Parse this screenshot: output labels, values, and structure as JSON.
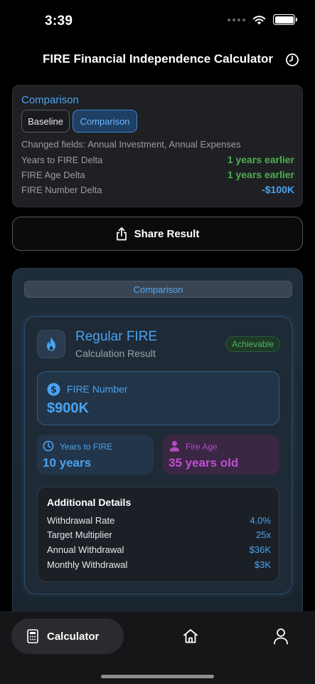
{
  "status": {
    "time": "3:39"
  },
  "header": {
    "title": "FIRE Financial Independence Calculator"
  },
  "comparison": {
    "heading": "Comparison",
    "segments": {
      "baseline": "Baseline",
      "comparison": "Comparison"
    },
    "changed_fields": "Changed fields: Annual Investment, Annual Expenses",
    "deltas": [
      {
        "label": "Years to FIRE Delta",
        "value": "1 years earlier"
      },
      {
        "label": "FIRE Age Delta",
        "value": "1 years earlier"
      },
      {
        "label": "FIRE Number Delta",
        "value": "-$100K"
      }
    ]
  },
  "share": {
    "label": "Share Result"
  },
  "result": {
    "tab_label": "Comparison",
    "fire_type": "Regular FIRE",
    "subtitle": "Calculation Result",
    "badge": "Achievable",
    "fire_number": {
      "label": "FIRE Number",
      "value": "$900K"
    },
    "years_to_fire": {
      "label": "Years to FIRE",
      "value": "10 years"
    },
    "fire_age": {
      "label": "Fire Age",
      "value": "35 years old"
    },
    "details": {
      "title": "Additional Details",
      "rows": [
        {
          "label": "Withdrawal Rate",
          "value": "4.0%"
        },
        {
          "label": "Target Multiplier",
          "value": "25x"
        },
        {
          "label": "Annual Withdrawal",
          "value": "$36K"
        },
        {
          "label": "Monthly Withdrawal",
          "value": "$3K"
        }
      ]
    }
  },
  "tabbar": {
    "calculator_label": "Calculator"
  },
  "colors": {
    "accent": "#4aa3f0",
    "success": "#4caf50",
    "purple": "#c14ed3",
    "background": "#000000"
  },
  "icons": [
    "history-icon",
    "share-icon",
    "flame-icon",
    "dollar-icon",
    "clock-icon",
    "person-icon",
    "calculator-icon",
    "home-icon",
    "profile-icon",
    "wifi-icon",
    "battery-icon"
  ]
}
